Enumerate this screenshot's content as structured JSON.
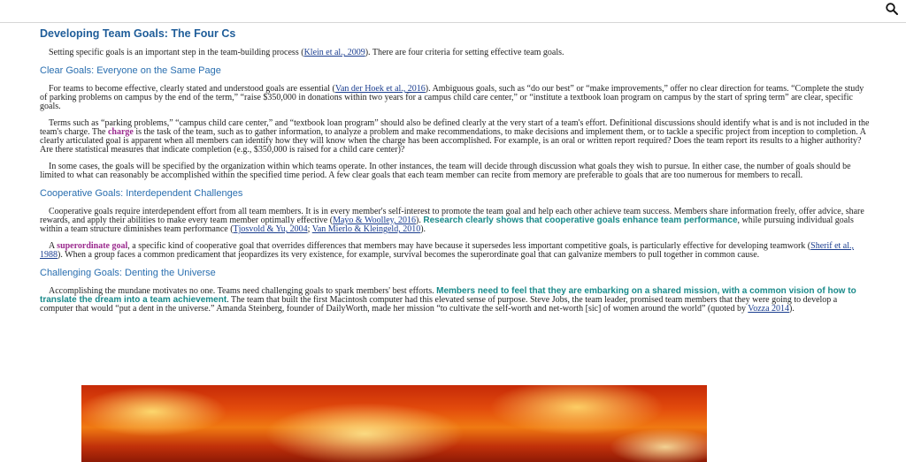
{
  "page": {
    "title": "Developing Team Goals: The Four Cs",
    "intro": {
      "t1": "Setting specific goals is an important step in the team-building process (",
      "cite1": "Klein et al., 2009",
      "t2": "). There are four criteria for setting effective team goals."
    },
    "s1": {
      "heading": "Clear Goals: Everyone on the Same Page",
      "p1": {
        "t1": "For teams to become effective, clearly stated and understood goals are essential (",
        "cite1": "Van der Hoek et al., 2016",
        "t2": "). Ambiguous goals, such as “do our best” or “make improvements,” offer no clear direction for teams. “Complete the study of parking problems on campus by the end of the term,” “raise $350,000 in donations within two years for a campus child care center,” or “institute a textbook loan program on campus by the start of spring term” are clear, specific goals."
      },
      "p2": {
        "t1": "Terms such as “parking problems,” “campus child care center,” and “textbook loan program” should also be defined clearly at the very start of a team's effort. Definitional discussions should identify what is and is not included in the team's charge. The ",
        "kw": "charge",
        "t2": " is the task of the team, such as to gather information, to analyze a problem and make recommendations, to make decisions and implement them, or to tackle a specific project from inception to completion. A clearly articulated goal is apparent when all members can identify how they will know when the charge has been accomplished. For example, is an oral or written report required? Does the team report its results to a higher authority? Are there statistical measures that indicate completion (e.g., $350,000 is raised for a child care center)?"
      },
      "p3": "In some cases, the goals will be specified by the organization within which teams operate. In other instances, the team will decide through discussion what goals they wish to pursue. In either case, the number of goals should be limited to what can reasonably be accomplished within the specified time period. A few clear goals that each team member can recite from memory are preferable to goals that are too numerous for members to recall."
    },
    "s2": {
      "heading": "Cooperative Goals: Interdependent Challenges",
      "p1": {
        "t1": "Cooperative goals require interdependent effort from all team members. It is in every member's self-interest to promote the team goal and help each other achieve team success. Members share information freely, offer advice, share rewards, and apply their abilities to make every team member optimally effective (",
        "cite1": "Mayo & Woolley, 2016",
        "t2": "). ",
        "hl": "Research clearly shows that cooperative goals enhance team performance",
        "t3": ", while pursuing individual goals within a team structure diminishes team performance (",
        "cite2": "Tjosvold & Yu, 2004",
        "t4": "; ",
        "cite3": "Van Mierlo & Kleingeld, 2010",
        "t5": ")."
      },
      "p2": {
        "t1": "A ",
        "kw": "superordinate goal",
        "t2": ", a specific kind of cooperative goal that overrides differences that members may have because it supersedes less important competitive goals, is particularly effective for developing teamwork (",
        "cite1": "Sherif et al., 1988",
        "t3": "). When a group faces a common predicament that jeopardizes its very existence, for example, survival becomes the superordinate goal that can galvanize members to pull together in common cause."
      }
    },
    "s3": {
      "heading": "Challenging Goals: Denting the Universe",
      "p1": {
        "t1": "Accomplishing the mundane motivates no one. Teams need challenging goals to spark members' best efforts. ",
        "hl": "Members need to feel that they are embarking on a shared mission, with a common vision of how to translate the dream into a team achievement",
        "t2": ". The team that built the first Macintosh computer had this elevated sense of purpose. Steve Jobs, the team leader, promised team members that they were going to develop a computer that would “put a dent in the universe.” Amanda Steinberg, founder of DailyWorth, made her mission “to cultivate the self-worth and net-worth [sic] of women around the world” (quoted by ",
        "cite1": "Vozza 2014",
        "t3": ")."
      }
    },
    "colors": {
      "title": "#1f5d99",
      "heading": "#2a6fb0",
      "keyword": "#9b2a8e",
      "highlight": "#1a8a8a",
      "link": "#1a3d8f"
    },
    "icons": {
      "search": "search-icon",
      "image": "fire-image"
    }
  }
}
